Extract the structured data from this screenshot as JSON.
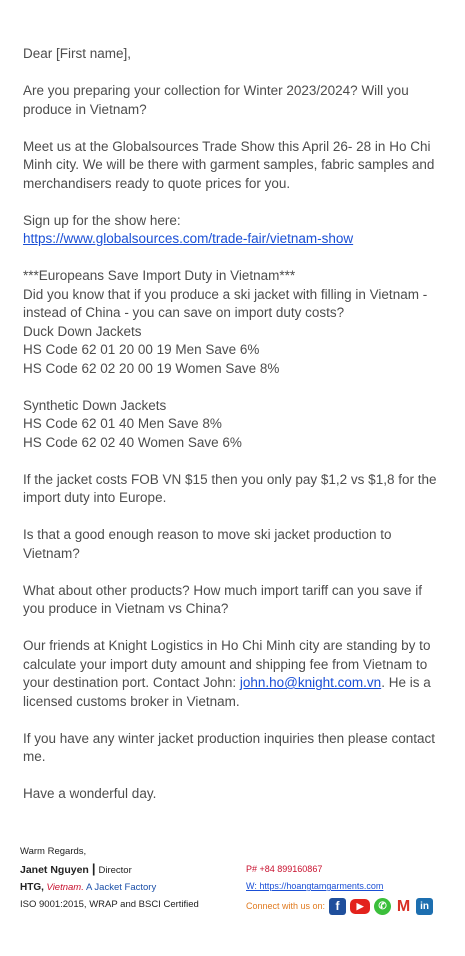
{
  "email": {
    "greeting": "Dear [First name],",
    "p1": "Are you preparing your collection for Winter 2023/2024?  Will you produce in Vietnam?",
    "p2": "Meet us at the Globalsources Trade Show this April 26- 28 in Ho Chi Minh city.  We will be there with garment samples, fabric samples and merchandisers ready to quote prices for you.",
    "signup_label": "Sign up for the show here:",
    "signup_link": "https://www.globalsources.com/trade-fair/vietnam-show",
    "duty_heading": "***Europeans Save Import Duty in Vietnam***",
    "duty_question": "Did you know that if you produce a ski jacket with filling in Vietnam - instead of China - you can save on import duty costs?",
    "duck_title": "Duck Down Jackets",
    "duck_men": "HS Code 62 01 20 00 19 Men Save 6%",
    "duck_women": "HS Code 62 02 20 00 19 Women Save 8%",
    "synth_title": "Synthetic Down Jackets",
    "synth_men": "HS Code 62 01 40  Men Save 8%",
    "synth_women": "HS Code 62 02 40  Women Save 6%",
    "p_cost": "If the jacket costs FOB VN $15 then you only pay $1,2 vs $1,8 for the import duty into Europe.",
    "p_reason": "Is that a good enough reason to move ski jacket production to Vietnam?",
    "p_other": "What about other products?  How much import tariff can you save if you produce in Vietnam vs China?",
    "p_friends_1": "Our friends at Knight Logistics in Ho Chi Minh city are standing by to calculate your import duty amount and shipping fee from Vietnam to your destination port. Contact John: ",
    "p_friends_email": "john.ho@knight.com.vn",
    "p_friends_2": ". He is a licensed customs broker in Vietnam.",
    "p_inquiries": "If you have any winter jacket production inquiries then please contact me.",
    "closing": "Have a wonderful day."
  },
  "signature": {
    "regards": "Warm Regards,",
    "name": "Janet Nguyen",
    "title": "Director",
    "company": "HTG,",
    "location": "Vietnam.",
    "tagline": "A Jacket Factory",
    "certs": "ISO 9001:2015, WRAP and BSCI Certified",
    "phone": "P# +84 899160867",
    "web": "W: https://hoangtamgarments.com",
    "connect": "Connect with us on:"
  },
  "social_icons": [
    "facebook-icon",
    "youtube-icon",
    "whatsapp-icon",
    "gmail-icon",
    "linkedin-icon"
  ]
}
